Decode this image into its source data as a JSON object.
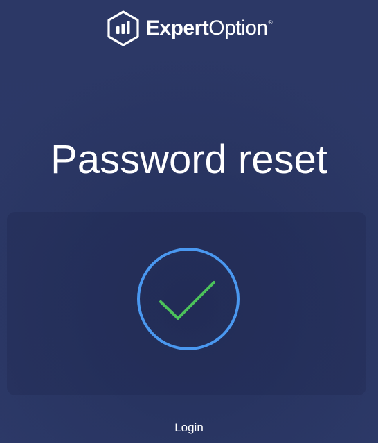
{
  "logo": {
    "name_bold": "Expert",
    "name_light": "Option",
    "registered_mark": "®",
    "icon": "expertoption-hexagon-bars-icon"
  },
  "page": {
    "title": "Password reset"
  },
  "status": {
    "icon": "success-check-circle-icon",
    "ring_color": "#4a98f0",
    "check_color": "#4cc25a"
  },
  "actions": {
    "login_label": "Login"
  },
  "colors": {
    "background": "#2c3866",
    "text": "#ffffff"
  }
}
